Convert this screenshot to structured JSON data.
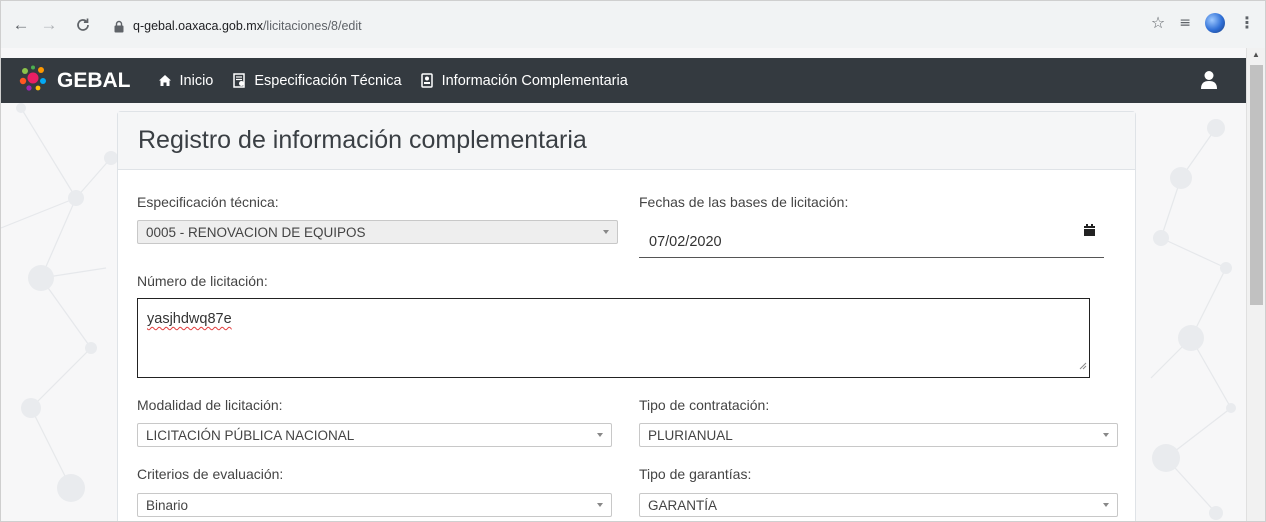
{
  "browser": {
    "url_host": "q-gebal.oaxaca.gob.mx",
    "url_path": "/licitaciones/8/edit",
    "back_icon": "arrow-left-icon",
    "forward_icon": "arrow-right-icon",
    "reload_icon": "reload-icon"
  },
  "navbar": {
    "brand": "GEBAL",
    "items": [
      {
        "label": "Inicio",
        "icon": "home-icon"
      },
      {
        "label": "Especificación Técnica",
        "icon": "document-gear-icon"
      },
      {
        "label": "Información Complementaria",
        "icon": "id-card-icon"
      }
    ],
    "user_icon": "user-icon",
    "bg_color": "#343a40"
  },
  "form": {
    "title": "Registro de información complementaria",
    "especificacion": {
      "label": "Especificación técnica:",
      "value": "0005 - RENOVACION DE EQUIPOS"
    },
    "fechas": {
      "label": "Fechas de las bases de licitación:",
      "value": "07/02/2020"
    },
    "numero": {
      "label": "Número de licitación:",
      "value": "yasjhdwq87e"
    },
    "modalidad": {
      "label": "Modalidad de licitación:",
      "value": "LICITACIÓN PÚBLICA NACIONAL"
    },
    "tipo_contratacion": {
      "label": "Tipo de contratación:",
      "value": "PLURIANUAL"
    },
    "criterios": {
      "label": "Criterios de evaluación:",
      "value": "Binario"
    },
    "tipo_garantias": {
      "label": "Tipo de garantías:",
      "value": "GARANTÍA"
    }
  }
}
